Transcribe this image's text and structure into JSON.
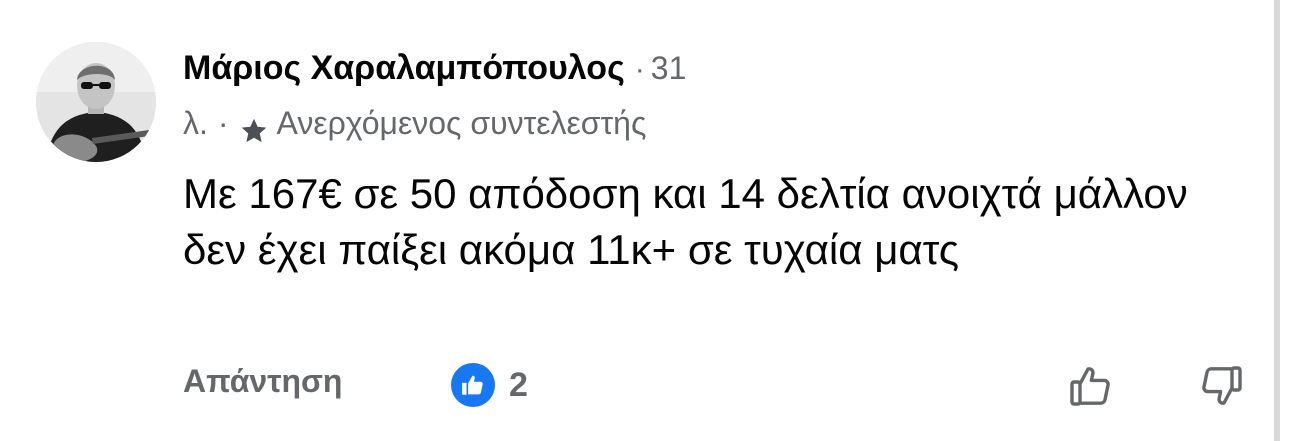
{
  "comment": {
    "author": "Μάριος Χαραλαμπόπουλος",
    "separator": "·",
    "time_part1": "31",
    "time_part2": "λ.",
    "badge_label": "Ανερχόμενος συντελεστής",
    "text": "Με 167€ σε 50 απόδοση και 14 δελτία ανοιχτά μάλλον δεν έχει παίξει ακόμα 11κ+ σε τυχαία ματς"
  },
  "actions": {
    "reply_label": "Απάντηση",
    "reaction_count": "2"
  },
  "colors": {
    "text_primary": "#050505",
    "text_secondary": "#65676b",
    "like_blue": "#1877f2"
  },
  "icons": {
    "badge": "star-icon",
    "reaction": "like-icon",
    "upvote": "thumbs-up-icon",
    "downvote": "thumbs-down-icon"
  }
}
